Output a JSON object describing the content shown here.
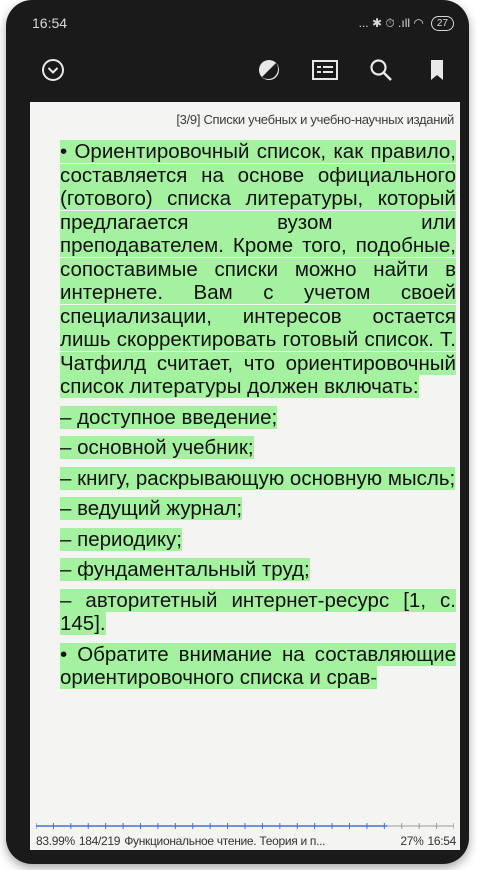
{
  "status_bar": {
    "time": "16:54",
    "icons": "... ✱ ⏱ .ıll ◠",
    "battery": "27"
  },
  "toolbar": {
    "menu_icon": "chevron-down-circle-icon",
    "night_icon": "contrast-icon",
    "toc_icon": "contents-icon",
    "search_icon": "search-icon",
    "bookmark_icon": "bookmark-icon"
  },
  "reader": {
    "chapter_header": "[3/9] Списки учебных и учебно-научных изданий",
    "paragraph1": "• Ориентировочный список, как правило, составляется на основе официального (готового) списка литературы, который предлагается вузом или преподавателем. Кроме того, подобные, сопоставимые списки можно найти в интернете. Вам с учетом своей специализации, интересов остается лишь скорректировать готовый список. Т. Чатфилд считает, что ориентировочный список литературы должен включать:",
    "items": [
      "– доступное введение;",
      "– основной учебник;",
      "– книгу, раскрывающую основную мысль;",
      "– ведущий журнал;",
      "– периодику;",
      "– фундаментальный труд;",
      "– авторитетный интернет-ресурс [1, с. 145]."
    ],
    "paragraph2": "• Обратите внимание на составляющие ориентировочного списка и срав-"
  },
  "footer": {
    "percent": "83.99%",
    "pages": "184/219",
    "book_title": "Функциональное чтение. Теория и п...",
    "battery": "27%",
    "time": "16:54",
    "progress_fraction": 0.84
  },
  "colors": {
    "highlight": "#a4f2a0",
    "page_background": "#f4f4f2",
    "progress_line": "#4a6fd6"
  }
}
